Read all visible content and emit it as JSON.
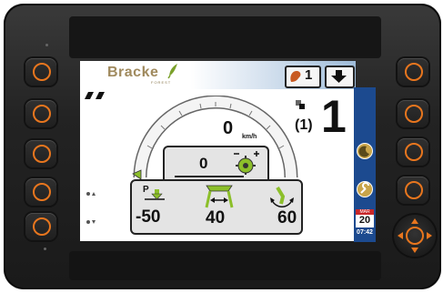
{
  "header": {
    "brand": "Bracke",
    "brand_sub": "FOREST",
    "tool_number": "1"
  },
  "gauge": {
    "speed_value": "0",
    "speed_unit": "km/h"
  },
  "gear": {
    "paren_label": "(1)",
    "number": "1"
  },
  "center_panel": {
    "value": "0"
  },
  "bottom_panel": {
    "pressure_label": "P",
    "pressure_value": "-50",
    "width_value": "40",
    "tilt_value": "60"
  },
  "calendar": {
    "month": "MAR",
    "day": "20",
    "time": "07:42"
  },
  "colors": {
    "bezel_accent": "#e8761e",
    "screen_bg": "#ffffff",
    "status_bar": "#1c4a8f",
    "brand_green": "#7aa02a",
    "brand_tan": "#a08a5e"
  },
  "icons": {
    "left_buttons": [
      "ring-button",
      "ring-button",
      "ring-button",
      "ring-button",
      "ring-button"
    ],
    "right_buttons": [
      "ring-button",
      "ring-button",
      "ring-button",
      "ring-button"
    ]
  }
}
